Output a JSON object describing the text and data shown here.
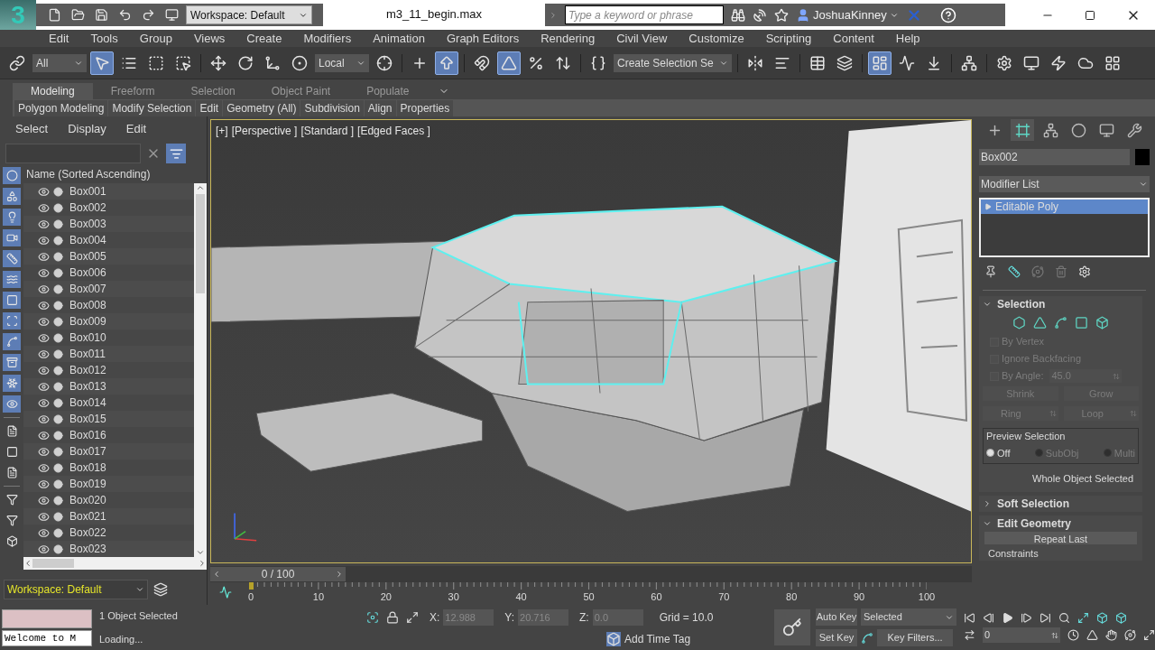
{
  "title_bar": {
    "logo": "3",
    "workspace": "Workspace: Default",
    "file_name": "m3_11_begin.max",
    "search": {
      "placeholder": "Type a keyword or phrase"
    },
    "user": "JoshuaKinney"
  },
  "menu": [
    "Edit",
    "Tools",
    "Group",
    "Views",
    "Create",
    "Modifiers",
    "Animation",
    "Graph Editors",
    "Rendering",
    "Civil View",
    "Customize",
    "Scripting",
    "Content",
    "Help"
  ],
  "main_toolbar": {
    "items": [
      {
        "kind": "link",
        "selected": false
      },
      {
        "kind": "dropdown",
        "value": "All"
      },
      {
        "kind": "select",
        "selected": true
      },
      {
        "kind": "select-by-name",
        "selected": false
      },
      {
        "kind": "region",
        "selected": false
      },
      {
        "kind": "crossing",
        "selected": false
      },
      {
        "kind": "separator"
      },
      {
        "kind": "move",
        "selected": false
      },
      {
        "kind": "rotate",
        "selected": false
      },
      {
        "kind": "scale",
        "selected": false
      },
      {
        "kind": "place",
        "selected": false
      },
      {
        "kind": "dropdown",
        "value": "Local"
      },
      {
        "kind": "pivot",
        "selected": false
      },
      {
        "kind": "separator"
      },
      {
        "kind": "manipulate",
        "selected": false
      },
      {
        "kind": "keyboard",
        "selected": true
      },
      {
        "kind": "separator"
      },
      {
        "kind": "snap",
        "selected": false
      },
      {
        "kind": "angle-snap",
        "selected": true
      },
      {
        "kind": "percent-snap",
        "selected": false
      },
      {
        "kind": "spinner-snap",
        "selected": false
      },
      {
        "kind": "separator"
      },
      {
        "kind": "named-selection",
        "selected": false
      },
      {
        "kind": "dropdown",
        "value": "Create Selection Se"
      },
      {
        "kind": "separator"
      },
      {
        "kind": "mirror",
        "selected": false
      },
      {
        "kind": "align",
        "selected": false
      },
      {
        "kind": "separator"
      },
      {
        "kind": "scene-explorer",
        "selected": false
      },
      {
        "kind": "layer-explorer",
        "selected": false
      },
      {
        "kind": "separator"
      },
      {
        "kind": "ribbon",
        "selected": true
      },
      {
        "kind": "curve-editor",
        "selected": false
      },
      {
        "kind": "schematic",
        "selected": false
      },
      {
        "kind": "separator"
      },
      {
        "kind": "material-editor",
        "selected": false
      },
      {
        "kind": "separator"
      },
      {
        "kind": "render-setup",
        "selected": false
      },
      {
        "kind": "frame-window",
        "selected": false
      },
      {
        "kind": "render",
        "selected": false
      },
      {
        "kind": "cloud-render",
        "selected": false
      },
      {
        "kind": "view-grid",
        "selected": false
      }
    ]
  },
  "ribbon": {
    "tabs": [
      {
        "label": "Modeling",
        "selected": true
      },
      {
        "label": "Freeform",
        "selected": false
      },
      {
        "label": "Selection",
        "selected": false
      },
      {
        "label": "Object Paint",
        "selected": false
      },
      {
        "label": "Populate",
        "selected": false
      }
    ],
    "panels": [
      "Polygon Modeling",
      "Modify Selection",
      "Edit",
      "Geometry (All)",
      "Subdivision",
      "Align",
      "Properties"
    ]
  },
  "scene_explorer": {
    "menu": [
      "Select",
      "Display",
      "Edit"
    ],
    "filter_toggle": {
      "selected": true
    },
    "filters": [
      {
        "kind": "geometry",
        "selected": true
      },
      {
        "kind": "shapes",
        "selected": true
      },
      {
        "kind": "lights",
        "selected": true
      },
      {
        "kind": "cameras",
        "selected": true
      },
      {
        "kind": "helpers",
        "selected": true
      },
      {
        "kind": "space-warps",
        "selected": true
      },
      {
        "kind": "groups",
        "selected": true
      },
      {
        "kind": "xrefs",
        "selected": true
      },
      {
        "kind": "bones",
        "selected": true
      },
      {
        "kind": "containers",
        "selected": true
      },
      {
        "kind": "frozen",
        "selected": true
      },
      {
        "kind": "hidden",
        "selected": true
      },
      {
        "kind": "separator"
      },
      {
        "kind": "all",
        "selected": false
      },
      {
        "kind": "none",
        "selected": false
      },
      {
        "kind": "invert",
        "selected": false
      },
      {
        "kind": "separator"
      },
      {
        "kind": "filter-settings",
        "selected": false
      },
      {
        "kind": "filter",
        "selected": false
      },
      {
        "kind": "hierarchy",
        "selected": false
      }
    ],
    "column": "Name (Sorted Ascending)",
    "items": [
      "Box001",
      "Box002",
      "Box003",
      "Box004",
      "Box005",
      "Box006",
      "Box007",
      "Box008",
      "Box009",
      "Box010",
      "Box011",
      "Box012",
      "Box013",
      "Box014",
      "Box015",
      "Box016",
      "Box017",
      "Box018",
      "Box019",
      "Box020",
      "Box021",
      "Box022",
      "Box023"
    ],
    "workspace": "Workspace: Default"
  },
  "viewport": {
    "labels": [
      "[+]",
      "[Perspective ]",
      "[Standard ]",
      "[Edged Faces ]"
    ]
  },
  "command_panel": {
    "tabs": [
      {
        "kind": "create",
        "selected": false
      },
      {
        "kind": "modify",
        "selected": true
      },
      {
        "kind": "hierarchy",
        "selected": false
      },
      {
        "kind": "motion",
        "selected": false
      },
      {
        "kind": "display",
        "selected": false
      },
      {
        "kind": "utilities",
        "selected": false
      }
    ],
    "object_name": "Box002",
    "modifier_list": "Modifier List",
    "stack": [
      {
        "label": "Editable Poly",
        "selected": true
      }
    ],
    "rollouts": [
      {
        "kind": "selection",
        "title": "Selection",
        "expanded": true,
        "checkboxes": [
          {
            "label": "By Vertex",
            "checked": false,
            "disabled": true
          },
          {
            "label": "Ignore Backfacing",
            "checked": false,
            "disabled": true
          },
          {
            "label": "By Angle:",
            "checked": false,
            "disabled": true
          }
        ],
        "angle": "45.0",
        "buttons": [
          "Shrink",
          "Grow"
        ],
        "spinner_buttons": [
          "Ring",
          "Loop"
        ],
        "preview": {
          "title": "Preview Selection",
          "options": [
            {
              "label": "Off",
              "selected": true,
              "disabled": false
            },
            {
              "label": "SubObj",
              "selected": false,
              "disabled": true
            },
            {
              "label": "Multi",
              "selected": false,
              "disabled": true
            }
          ]
        },
        "status": "Whole Object Selected"
      },
      {
        "title": "Soft Selection",
        "expanded": false
      },
      {
        "kind": "geometry",
        "title": "Edit Geometry",
        "expanded": true,
        "button": "Repeat Last",
        "group": "Constraints"
      }
    ]
  },
  "timeline": {
    "frame": "0 / 100",
    "level": 0,
    "ticks": [
      "0",
      "10",
      "20",
      "30",
      "40",
      "50",
      "60",
      "70",
      "80",
      "90",
      "100"
    ]
  },
  "status_bar": {
    "listener": "Welcome to M",
    "selection": "1 Object Selected",
    "prompt": "Loading...",
    "coords": [
      {
        "label": "X:",
        "value": "12.988"
      },
      {
        "label": "Y:",
        "value": "20.716"
      },
      {
        "label": "Z:",
        "value": "0.0"
      }
    ],
    "grid": "Grid = 10.0",
    "time_tag": "Add Time Tag",
    "auto_key": {
      "label": "Auto Key",
      "selected": false
    },
    "key_mode": "Selected",
    "set_key": "Set Key",
    "key_filters": "Key Filters...",
    "current_frame": "0"
  }
}
